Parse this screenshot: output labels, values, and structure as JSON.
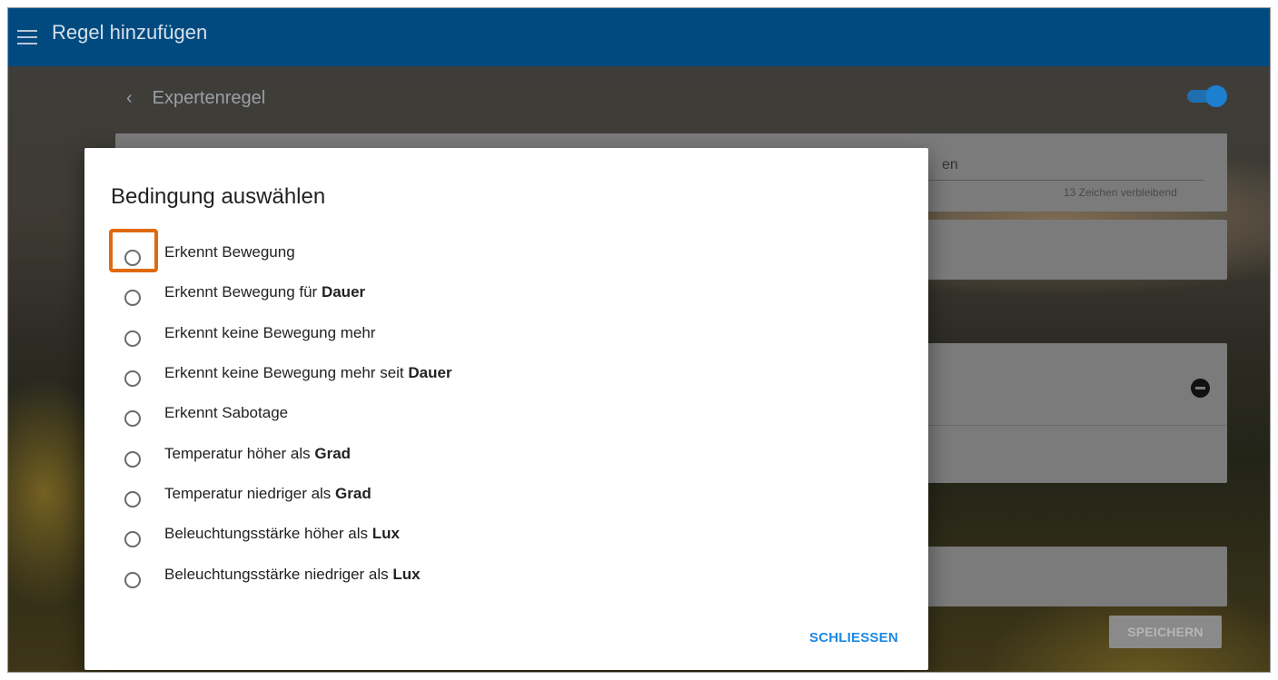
{
  "appbar": {
    "title": "Regel hinzufügen"
  },
  "page": {
    "header": "Expertenregel",
    "name_field_partial": "en",
    "counter": "13 Zeichen verbleibend",
    "save_label": "SPEICHERN"
  },
  "dialog": {
    "title": "Bedingung auswählen",
    "options": [
      {
        "text": "Erkennt Bewegung",
        "bold": ""
      },
      {
        "text": "Erkennt Bewegung für ",
        "bold": "Dauer"
      },
      {
        "text": "Erkennt keine Bewegung mehr",
        "bold": ""
      },
      {
        "text": "Erkennt keine Bewegung mehr seit ",
        "bold": "Dauer"
      },
      {
        "text": "Erkennt Sabotage",
        "bold": ""
      },
      {
        "text": "Temperatur höher als ",
        "bold": "Grad"
      },
      {
        "text": "Temperatur niedriger als ",
        "bold": "Grad"
      },
      {
        "text": "Beleuchtungsstärke höher als ",
        "bold": "Lux"
      },
      {
        "text": "Beleuchtungsstärke niedriger als ",
        "bold": "Lux"
      }
    ],
    "close_label": "SCHLIESSEN"
  },
  "colors": {
    "appbar": "#004a80",
    "highlight": "#e06a10",
    "accent": "#1e88e5"
  },
  "icons": {
    "menu": "menu-icon",
    "back": "chevron-left-icon",
    "remove": "remove-circle-icon"
  }
}
